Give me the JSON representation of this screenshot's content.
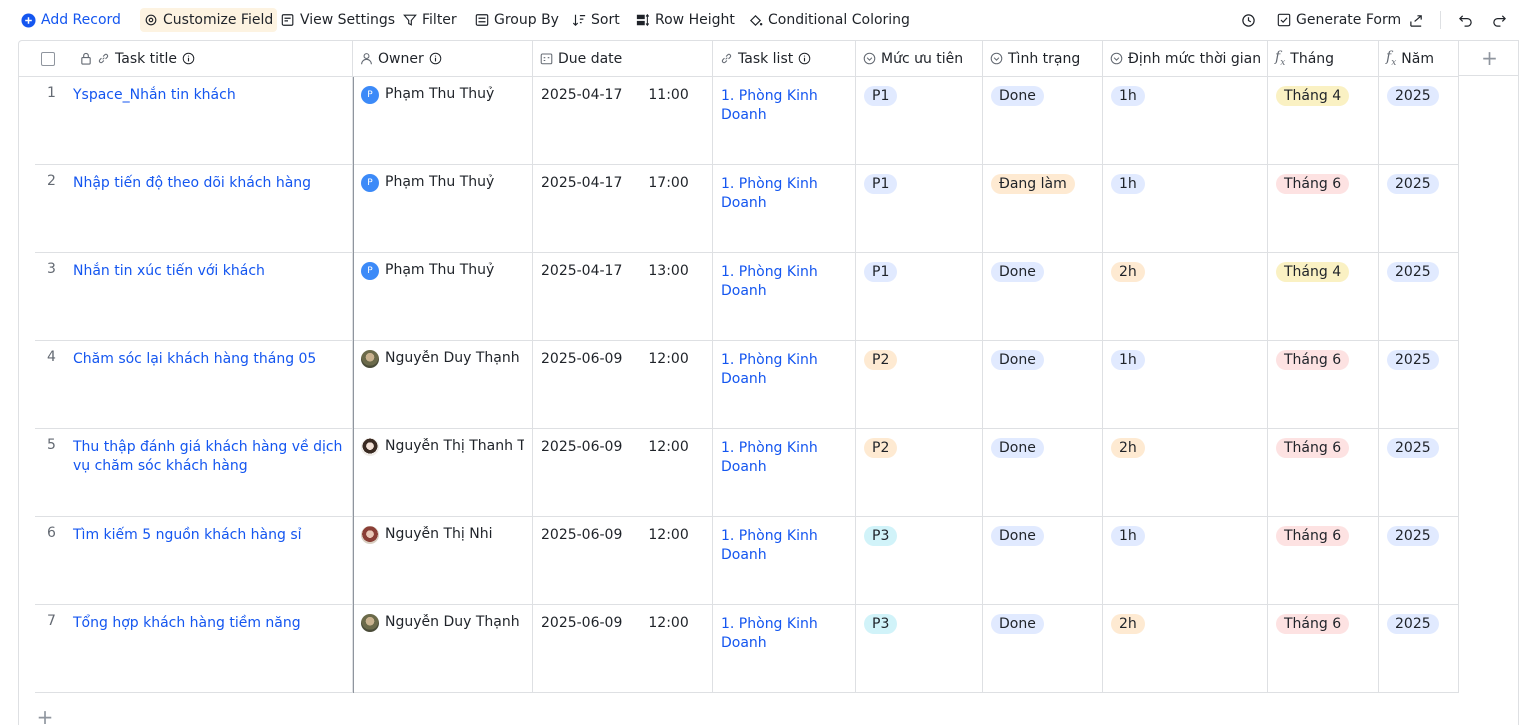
{
  "toolbar": {
    "add_record": "Add Record",
    "customize_field": "Customize Field",
    "view_settings": "View Settings",
    "filter": "Filter",
    "group_by": "Group By",
    "sort": "Sort",
    "row_height": "Row Height",
    "conditional_coloring": "Conditional Coloring",
    "generate_form": "Generate Form"
  },
  "columns": {
    "task_title": "Task title",
    "owner": "Owner",
    "due_date": "Due date",
    "task_list": "Task list",
    "priority": "Mức ưu tiên",
    "status": "Tình trạng",
    "time_norm": "Định mức thời gian",
    "month": "Tháng",
    "year": "Năm"
  },
  "rows": [
    {
      "index": "1",
      "title": "Yspace_Nhắn tin khách",
      "owner": "Phạm Thu Thuỷ",
      "owner_avatar": "P",
      "date": "2025-04-17",
      "time": "11:00",
      "task_list": "1. Phòng Kinh Doanh",
      "priority": "P1",
      "status": "Done",
      "norm": "1h",
      "month": "Tháng 4",
      "year": "2025"
    },
    {
      "index": "2",
      "title": "Nhập tiến độ theo dõi khách hàng",
      "owner": "Phạm Thu Thuỷ",
      "owner_avatar": "P",
      "date": "2025-04-17",
      "time": "17:00",
      "task_list": "1. Phòng Kinh Doanh",
      "priority": "P1",
      "status": "Đang làm",
      "norm": "1h",
      "month": "Tháng 6",
      "year": "2025"
    },
    {
      "index": "3",
      "title": "Nhắn tin xúc tiến với khách",
      "owner": "Phạm Thu Thuỷ",
      "owner_avatar": "P",
      "date": "2025-04-17",
      "time": "13:00",
      "task_list": "1. Phòng Kinh Doanh",
      "priority": "P1",
      "status": "Done",
      "norm": "2h",
      "month": "Tháng 4",
      "year": "2025"
    },
    {
      "index": "4",
      "title": "Chăm sóc lại khách hàng tháng 05",
      "owner": "Nguyễn Duy Thạnh",
      "owner_avatar": "",
      "date": "2025-06-09",
      "time": "12:00",
      "task_list": "1. Phòng Kinh Doanh",
      "priority": "P2",
      "status": "Done",
      "norm": "1h",
      "month": "Tháng 6",
      "year": "2025"
    },
    {
      "index": "5",
      "title": "Thu thập đánh giá khách hàng về dịch vụ chăm sóc khách hàng",
      "owner": "Nguyễn Thị Thanh Thư",
      "owner_avatar": "",
      "date": "2025-06-09",
      "time": "12:00",
      "task_list": "1. Phòng Kinh Doanh",
      "priority": "P2",
      "status": "Done",
      "norm": "2h",
      "month": "Tháng 6",
      "year": "2025"
    },
    {
      "index": "6",
      "title": "Tìm kiếm 5 nguồn khách hàng sỉ",
      "owner": "Nguyễn Thị  Nhi",
      "owner_avatar": "",
      "date": "2025-06-09",
      "time": "12:00",
      "task_list": "1. Phòng Kinh Doanh",
      "priority": "P3",
      "status": "Done",
      "norm": "1h",
      "month": "Tháng 6",
      "year": "2025"
    },
    {
      "index": "7",
      "title": "Tổng hợp khách hàng tiềm năng",
      "owner": "Nguyễn Duy Thạnh",
      "owner_avatar": "",
      "date": "2025-06-09",
      "time": "12:00",
      "task_list": "1. Phòng Kinh Doanh",
      "priority": "P3",
      "status": "Done",
      "norm": "2h",
      "month": "Tháng 6",
      "year": "2025"
    }
  ],
  "colors": {
    "accent": "#1456f0",
    "tag_blue": "#e1eaff",
    "tag_orange": "#feead2",
    "tag_cyan": "#d1f3f9",
    "tag_yellow": "#faf1c3",
    "tag_pink": "#fde2e2"
  }
}
